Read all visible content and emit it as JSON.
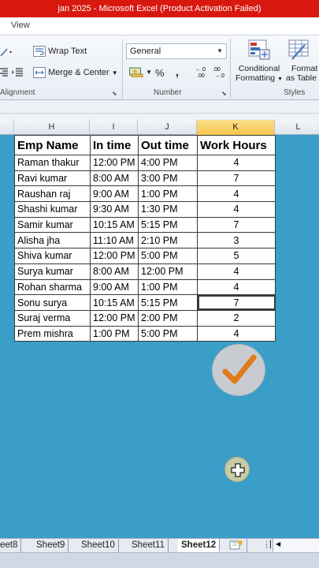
{
  "window": {
    "title": "jan 2025  -  Microsoft Excel (Product Activation Failed)"
  },
  "menu": {
    "visible_tab": "View"
  },
  "ribbon": {
    "wrap_text": "Wrap Text",
    "merge_center": "Merge & Center",
    "alignment_label": "Alignment",
    "number_format": "General",
    "percent": "%",
    "comma": ",",
    "number_label": "Number",
    "conditional_line1": "Conditional",
    "conditional_line2": "Formatting",
    "format_line1": "Format",
    "format_line2": "as Table",
    "styles_label": "Styles"
  },
  "columns": [
    "H",
    "I",
    "J",
    "K",
    "L"
  ],
  "active_column": "K",
  "table": {
    "headers": [
      "Emp Name",
      "In time",
      "Out time",
      "Work Hours"
    ],
    "rows": [
      [
        "Raman thakur",
        "12:00 PM",
        "4:00 PM",
        "4"
      ],
      [
        "Ravi kumar",
        "8:00 AM",
        "3:00 PM",
        "7"
      ],
      [
        "Raushan raj",
        "9:00 AM",
        "1:00 PM",
        "4"
      ],
      [
        "Shashi kumar",
        "9:30 AM",
        "1:30 PM",
        "4"
      ],
      [
        "Samir kumar",
        "10:15 AM",
        "5:15 PM",
        "7"
      ],
      [
        "Alisha jha",
        "11:10 AM",
        "2:10 PM",
        "3"
      ],
      [
        "Shiva kumar",
        "12:00 PM",
        "5:00 PM",
        "5"
      ],
      [
        "Surya kumar",
        "8:00 AM",
        "12:00 PM",
        "4"
      ],
      [
        "Rohan sharma",
        "9:00 AM",
        "1:00 PM",
        "4"
      ],
      [
        "Sonu surya",
        "10:15 AM",
        "5:15 PM",
        "7"
      ],
      [
        "Suraj verma",
        "12:00 PM",
        "2:00 PM",
        "2"
      ],
      [
        "Prem mishra",
        "1:00 PM",
        "5:00 PM",
        "4"
      ]
    ]
  },
  "sheets": [
    "eet8",
    "Sheet9",
    "Sheet10",
    "Sheet11",
    "Sheet12"
  ],
  "active_sheet": "Sheet12",
  "colors": {
    "accent_title": "#d8180f",
    "sheet_bg": "#3a9ec8",
    "check": "#e07b1a"
  }
}
